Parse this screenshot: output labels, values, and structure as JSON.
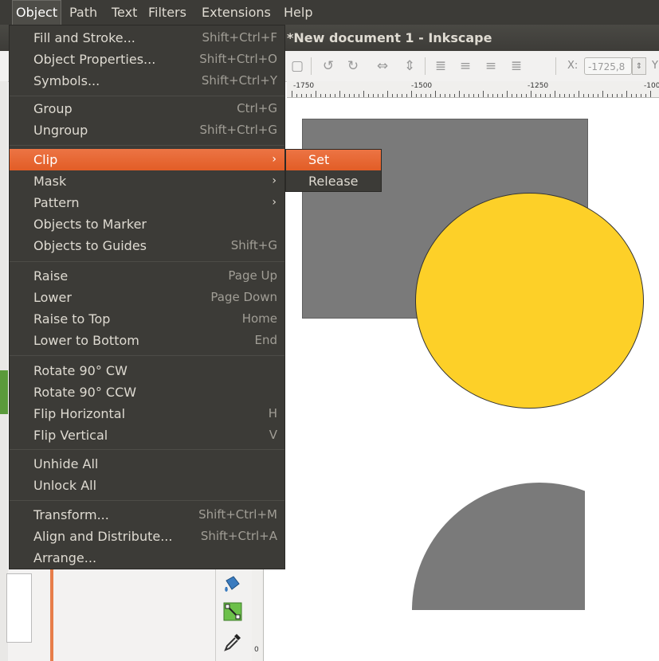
{
  "menubar": {
    "items": [
      "Object",
      "Path",
      "Text",
      "Filters",
      "Extensions",
      "Help"
    ]
  },
  "window": {
    "title": "*New document 1 - Inkscape"
  },
  "toolbar": {
    "x_label": "X:",
    "x_value": "-1725,8",
    "spin": "⇕",
    "more": "Y"
  },
  "ruler": {
    "labels": [
      "-1750",
      "-1500",
      "-1250",
      "-100"
    ]
  },
  "palette": {
    "vruler_label": "0"
  },
  "object_menu": {
    "items": [
      {
        "label": "Fill and Stroke...",
        "shortcut": "Shift+Ctrl+F"
      },
      {
        "label": "Object Properties...",
        "shortcut": "Shift+Ctrl+O"
      },
      {
        "label": "Symbols...",
        "shortcut": "Shift+Ctrl+Y"
      },
      {
        "label": "Group",
        "shortcut": "Ctrl+G"
      },
      {
        "label": "Ungroup",
        "shortcut": "Shift+Ctrl+G"
      },
      {
        "label": "Clip",
        "submenu": true
      },
      {
        "label": "Mask",
        "submenu": true
      },
      {
        "label": "Pattern",
        "submenu": true
      },
      {
        "label": "Objects to Marker",
        "shortcut": ""
      },
      {
        "label": "Objects to Guides",
        "shortcut": "Shift+G"
      },
      {
        "label": "Raise",
        "shortcut": "Page Up"
      },
      {
        "label": "Lower",
        "shortcut": "Page Down"
      },
      {
        "label": "Raise to Top",
        "shortcut": "Home"
      },
      {
        "label": "Lower to Bottom",
        "shortcut": "End"
      },
      {
        "label": "Rotate 90° CW",
        "shortcut": ""
      },
      {
        "label": "Rotate 90° CCW",
        "shortcut": ""
      },
      {
        "label": "Flip Horizontal",
        "shortcut": "H"
      },
      {
        "label": "Flip Vertical",
        "shortcut": "V"
      },
      {
        "label": "Unhide All",
        "shortcut": ""
      },
      {
        "label": "Unlock All",
        "shortcut": ""
      },
      {
        "label": "Transform...",
        "shortcut": "Shift+Ctrl+M"
      },
      {
        "label": "Align and Distribute...",
        "shortcut": "Shift+Ctrl+A"
      },
      {
        "label": "Arrange...",
        "shortcut": ""
      }
    ],
    "submenu_arrow": "›"
  },
  "clip_submenu": {
    "items": [
      "Set",
      "Release"
    ]
  },
  "colors": {
    "menu_bg": "#3c3b37",
    "highlight": "#e9682e",
    "circle_fill": "#fdd028",
    "rect_fill": "#7a7a7a"
  }
}
